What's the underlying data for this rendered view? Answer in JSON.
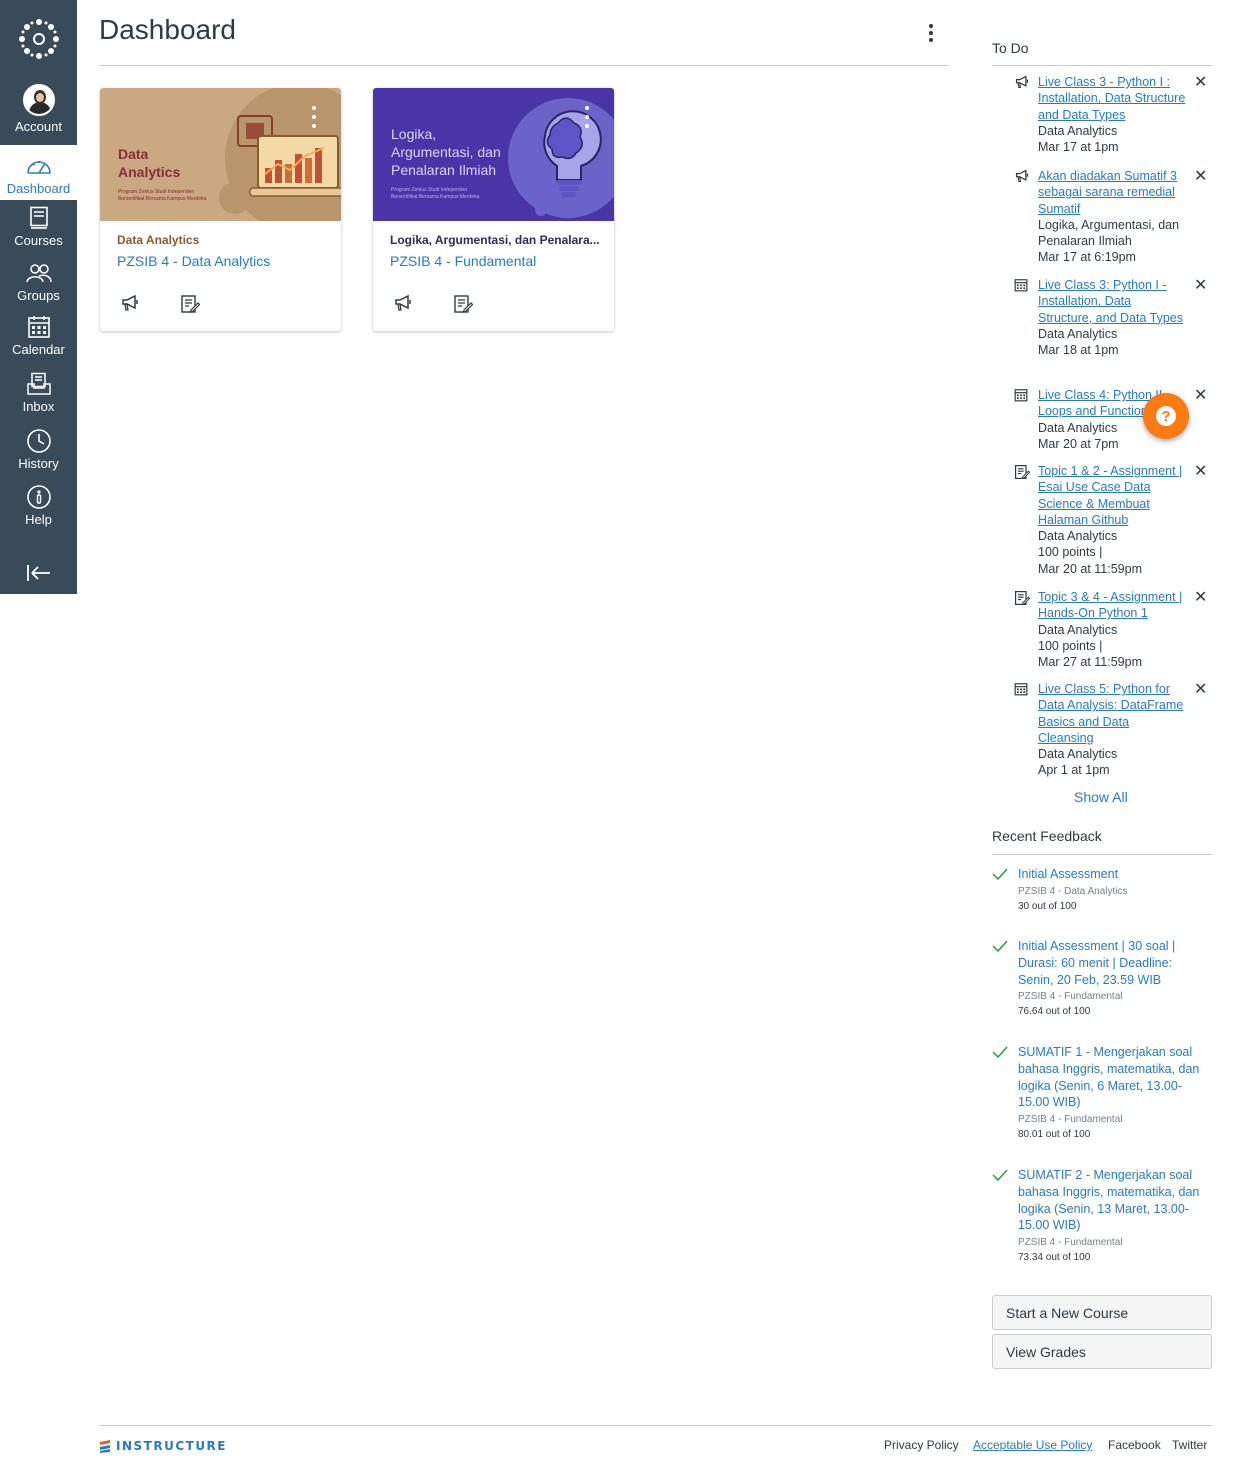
{
  "nav": {
    "account": "Account",
    "dashboard": "Dashboard",
    "courses": "Courses",
    "groups": "Groups",
    "calendar": "Calendar",
    "inbox": "Inbox",
    "history": "History",
    "help": "Help"
  },
  "page": {
    "title": "Dashboard"
  },
  "cards": [
    {
      "hero_title_1": "Data",
      "hero_title_2": "Analytics",
      "hero_small_1": "Program Zenius Studi Independen",
      "hero_small_2": "Bersertifikat Bersama Kampus Merdeka",
      "subtitle": "Data Analytics",
      "course": "PZSIB 4 - Data Analytics",
      "hero_color": "#c9a882",
      "subtitle_color": "#8a5a2b"
    },
    {
      "hero_title_1": "Logika,",
      "hero_title_2": "Argumentasi, dan",
      "hero_title_3": "Penalaran Ilmiah",
      "hero_small_1": "Program Zenius Studi Independen",
      "hero_small_2": "Bersertifikat Bersama Kampus Merdeka",
      "subtitle": "Logika, Argumentasi, dan Penalara...",
      "course": "PZSIB 4 - Fundamental",
      "hero_color": "#4a35a8",
      "subtitle_color": "#2d2b5a"
    }
  ],
  "todo": {
    "heading": "To Do",
    "items": [
      {
        "icon": "announcement-icon",
        "title": "Live Class 3 - Python I : Installation, Data Structure and Data Types",
        "course": "Data Analytics",
        "points": "",
        "date": "Mar 17 at 1pm"
      },
      {
        "icon": "announcement-icon",
        "title": "Akan diadakan Sumatif 3 sebagai sarana remedial Sumatif",
        "course": "Logika, Argumentasi, dan Penalaran Ilmiah",
        "points": "",
        "date": "Mar 17 at 6:19pm"
      },
      {
        "icon": "calendar-icon",
        "title": "Live Class 3: Python I - Installation, Data Structure, and Data Types",
        "course": "Data Analytics",
        "points": "",
        "date": "Mar 18 at 1pm"
      },
      {
        "icon": "calendar-icon",
        "title": "Live Class 4: Python II - Loops and Functions",
        "course": "Data Analytics",
        "points": "",
        "date": "Mar 20 at 7pm"
      },
      {
        "icon": "assignment-icon",
        "title": "Topic 1 & 2 - Assignment | Esai Use Case Data Science & Membuat Halaman Github",
        "course": "Data Analytics",
        "points": "100 points |",
        "date": "Mar 20 at 11:59pm"
      },
      {
        "icon": "assignment-icon",
        "title": "Topic 3 & 4 - Assignment | Hands-On Python 1",
        "course": "Data Analytics",
        "points": "100 points |",
        "date": "Mar 27 at 11:59pm"
      },
      {
        "icon": "calendar-icon",
        "title": "Live Class 5: Python for Data Analysis: DataFrame Basics and Data Cleansing",
        "course": "Data Analytics",
        "points": "",
        "date": "Apr 1 at 1pm"
      }
    ],
    "close": "✕",
    "show_all": "Show All"
  },
  "feedback": {
    "heading": "Recent Feedback",
    "items": [
      {
        "title": "Initial Assessment",
        "course": "PZSIB 4 - Data Analytics",
        "score": "30 out of 100"
      },
      {
        "title": "Initial Assessment | 30 soal | Durasi: 60 menit | Deadline: Senin, 20 Feb, 23.59 WIB",
        "course": "PZSIB 4 - Fundamental",
        "score": "76.64 out of 100"
      },
      {
        "title": "SUMATIF 1 - Mengerjakan soal bahasa Inggris, matematika, dan logika (Senin, 6 Maret, 13.00-15.00 WIB)",
        "course": "PZSIB 4 - Fundamental",
        "score": "80.01 out of 100"
      },
      {
        "title": "SUMATIF 2 - Mengerjakan soal bahasa Inggris, matematika, dan logika (Senin, 13 Maret, 13.00-15.00 WIB)",
        "course": "PZSIB 4 - Fundamental",
        "score": "73.34 out of 100"
      }
    ]
  },
  "buttons": {
    "new_course": "Start a New Course",
    "view_grades": "View Grades"
  },
  "footer": {
    "brand": "INSTRUCTURE",
    "privacy": "Privacy Policy",
    "aup": "Acceptable Use Policy",
    "facebook": "Facebook",
    "twitter": "Twitter"
  },
  "colors": {
    "nav_bg": "#394b58",
    "link": "#2b7abc",
    "help_fab": "#fc7a12"
  }
}
